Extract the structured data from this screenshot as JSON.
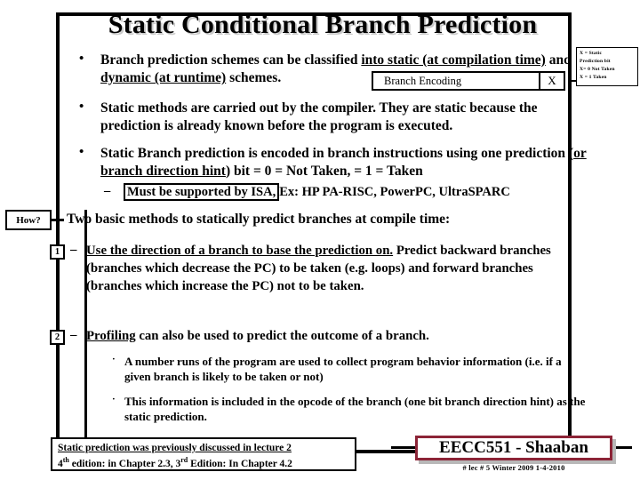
{
  "slide": {
    "title": "Static Conditional Branch Prediction",
    "bullets": [
      {
        "pre": "Branch prediction schemes can be classified ",
        "u1": "into static (at compilation time)",
        "mid": " and ",
        "u2": "dynamic (at runtime)",
        "post": " schemes."
      },
      {
        "pre": "Static methods are carried out by the compiler. They are static because the prediction is already known before the program is executed.",
        "u1": "",
        "mid": "",
        "u2": "",
        "post": ""
      },
      {
        "pre": "Static Branch prediction is encoded in branch instructions using one prediction (",
        "u1": "or branch direction hint",
        "mid": ") bit = 0  = Not Taken,   = 1 = Taken",
        "u2": "",
        "post": ""
      }
    ],
    "isa_sub": {
      "boxed": "Must be supported by ISA,",
      "rest": "Ex:   HP PA-RISC, PowerPC, UltraSPARC"
    },
    "encoding_table": {
      "label": "Branch Encoding",
      "bit_cell": "X"
    },
    "legend": {
      "line1": "X = Static",
      "line2": "Prediction bit",
      "line3": "X= 0  Not Taken",
      "line4": "X = 1  Taken"
    },
    "how_badge": "How?",
    "intro": "Two basic methods to statically predict branches at compile time:",
    "methods": [
      {
        "number": "1",
        "dash": "–",
        "underlined": "Use the direction of a branch to base the prediction on.",
        "rest": "  Predict backward branches (branches which decrease the PC) to be taken (e.g. loops) and forward branches (branches which increase the PC) not to be taken."
      },
      {
        "number": "2",
        "dash": "–",
        "underlined": "Profiling",
        "rest": " can also be used to predict the outcome of a branch."
      }
    ],
    "sub_points": [
      "A number runs of the program are used to collect program behavior information (i.e. if a given branch is likely to be taken or not)",
      "This information is included in the opcode of the branch (one bit branch direction hint) as the static prediction."
    ],
    "note": {
      "line1": "Static prediction was previously discussed in lecture 2",
      "line2_a": "4",
      "line2_sup1": "th",
      "line2_b": " edition:  in Chapter 2.3,  3",
      "line2_sup2": "rd",
      "line2_c": " Edition: In Chapter 4.2"
    },
    "footer": {
      "course": "EECC551 - Shaaban",
      "meta": "#  lec # 5   Winter 2009   1-4-2010"
    },
    "colors": {
      "accent_red": "#8c2437",
      "title_shadow": "#c9c9c9",
      "text": "#000000",
      "background": "#ffffff"
    },
    "bullet_glyph": "•",
    "sub_glyph": "·"
  }
}
